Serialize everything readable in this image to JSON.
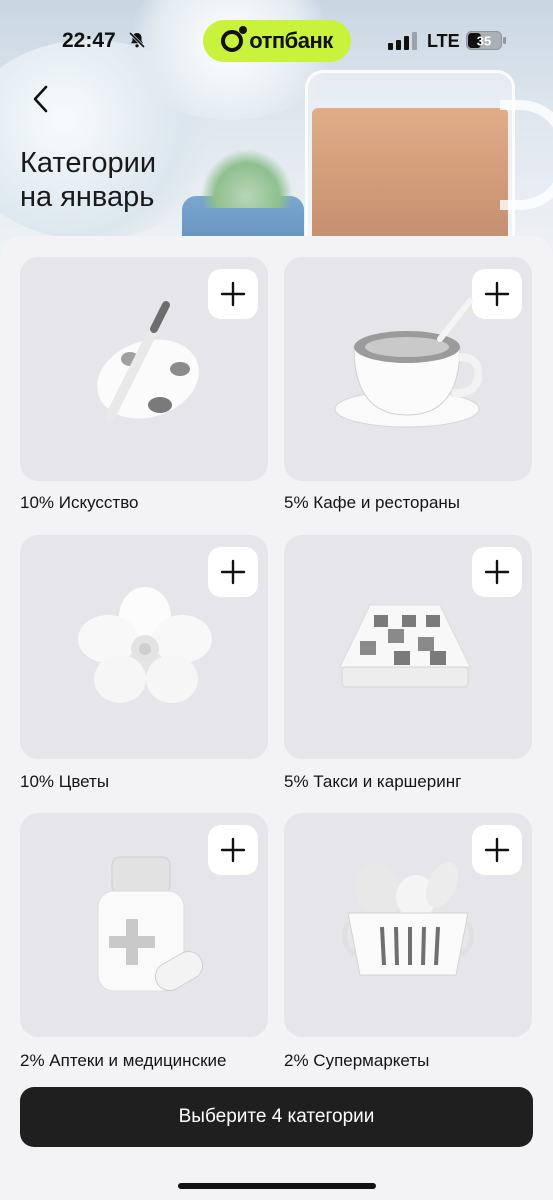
{
  "status_bar": {
    "time": "22:47",
    "network": "LTE",
    "battery": "35",
    "icons": [
      "bell-slash-icon",
      "signal-icon",
      "battery-icon"
    ]
  },
  "brand": {
    "name": "отпбанк",
    "accent_color": "#c8f23c"
  },
  "header": {
    "back_icon": "chevron-left-icon",
    "title": "Категории\nна январь"
  },
  "categories": [
    {
      "label": "10% Искусство",
      "icon": "palette-icon",
      "add_icon": "plus-icon"
    },
    {
      "label": "5% Кафе и рестораны",
      "icon": "coffee-cup-icon",
      "add_icon": "plus-icon"
    },
    {
      "label": "10% Цветы",
      "icon": "flower-icon",
      "add_icon": "plus-icon"
    },
    {
      "label": "5% Такси и каршеринг",
      "icon": "taxi-sign-icon",
      "add_icon": "plus-icon"
    },
    {
      "label": "2% Аптеки и медицинские",
      "icon": "pill-bottle-icon",
      "add_icon": "plus-icon"
    },
    {
      "label": "2% Супермаркеты",
      "icon": "grocery-basket-icon",
      "add_icon": "plus-icon"
    }
  ],
  "cta": {
    "label": "Выберите 4 категории",
    "background": "#1f1f1f"
  }
}
